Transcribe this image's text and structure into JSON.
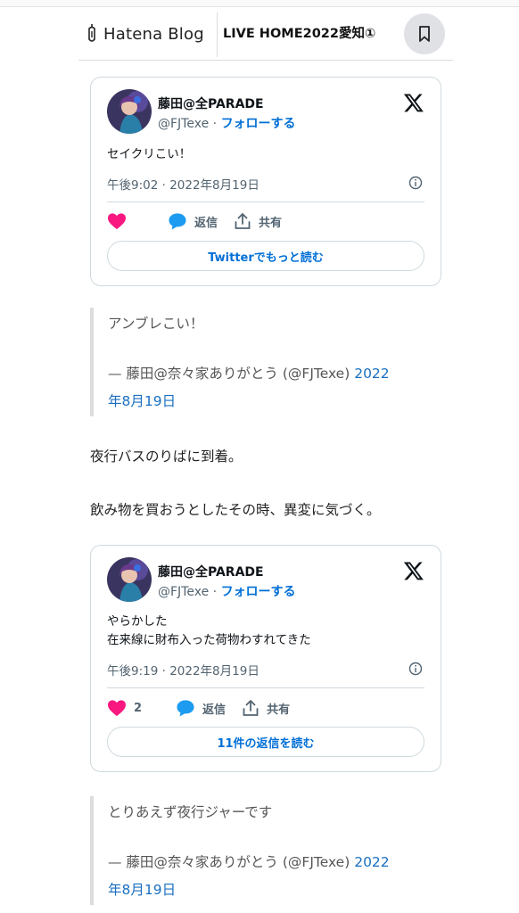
{
  "header": {
    "logo_text": "Hatena Blog",
    "blog_title": "LIVE HOME2022愛知①"
  },
  "tweets": [
    {
      "name": "藤田@全PARADE",
      "handle": "@FJTexe",
      "separator": " · ",
      "follow_label": "フォローする",
      "text_lines": [
        "セイクリこい！"
      ],
      "timestamp": "午後9:02 · 2022年8月19日",
      "like_count": "",
      "reply_label": "返信",
      "share_label": "共有",
      "readmore_label": "Twitterでもっと読む"
    },
    {
      "name": "藤田@全PARADE",
      "handle": "@FJTexe",
      "separator": " · ",
      "follow_label": "フォローする",
      "text_lines": [
        "やらかした",
        "在来線に財布入った荷物わすれてきた"
      ],
      "timestamp": "午後9:19 · 2022年8月19日",
      "like_count": "2",
      "reply_label": "返信",
      "share_label": "共有",
      "readmore_label": "11件の返信を読む"
    }
  ],
  "quotes": [
    {
      "text": "アンブレこい！",
      "cite_prefix": "— 藤田@奈々家ありがとう (@FJTexe) ",
      "cite_link_line1": "2022",
      "cite_link_line2": "年8月19日"
    },
    {
      "text": "とりあえず夜行ジャーです",
      "cite_prefix": "— 藤田@奈々家ありがとう (@FJTexe) ",
      "cite_link_line1": "2022",
      "cite_link_line2": "年8月19日"
    }
  ],
  "paragraphs": [
    "夜行バスのりばに到着。",
    "飲み物を買おうとしたその時、異変に気づく。"
  ],
  "colors": {
    "like_pink": "#f91880",
    "reply_blue": "#1d9bf0",
    "link_blue": "#006fd6"
  },
  "icons": [
    "hatena-pen-icon",
    "bookmark-icon",
    "x-logo-icon",
    "info-icon",
    "heart-icon",
    "reply-bubble-icon",
    "share-icon"
  ]
}
